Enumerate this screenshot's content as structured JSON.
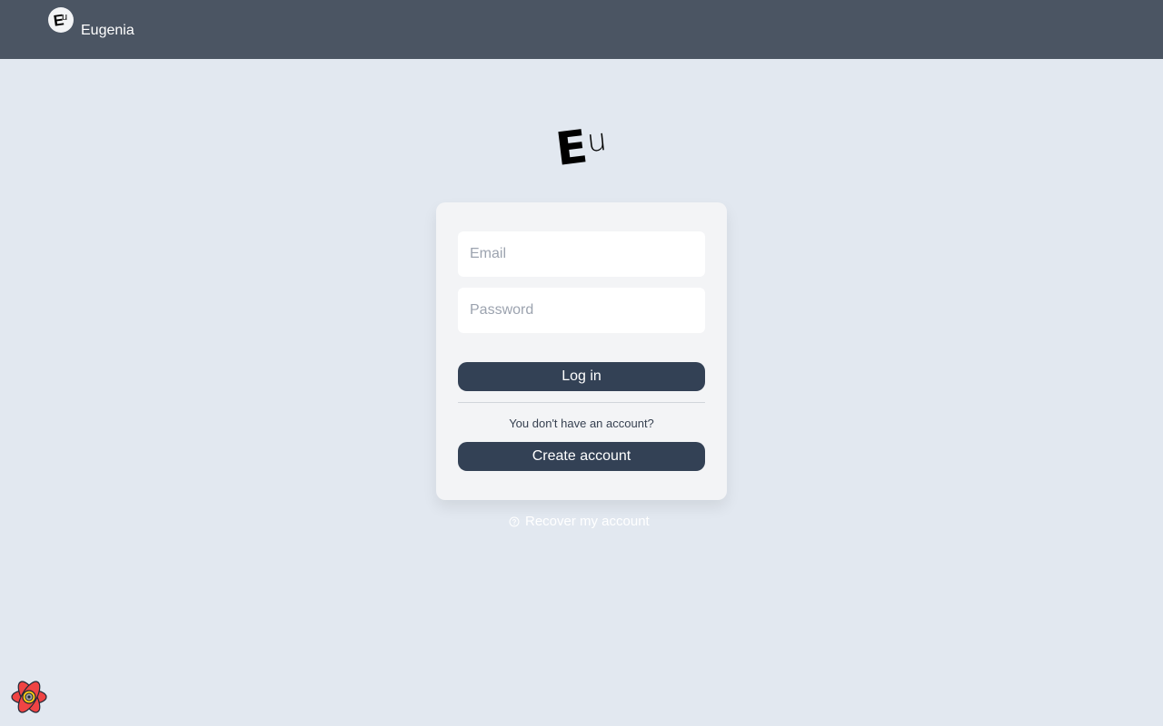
{
  "header": {
    "brand_name": "Eugenia",
    "avatar_big": "E",
    "avatar_small": "u"
  },
  "logo": {
    "big": "E",
    "small": "u"
  },
  "form": {
    "email_placeholder": "Email",
    "email_value": "",
    "password_placeholder": "Password",
    "password_value": "",
    "login_label": "Log in",
    "no_account_text": "You don't have an account?",
    "create_account_label": "Create account"
  },
  "recover": {
    "label": "Recover my account",
    "icon": "question-circle-icon"
  },
  "devtools": {
    "icon": "react-query-devtools-icon"
  },
  "colors": {
    "background": "#e2e8f0",
    "topbar": "#4b5563",
    "card": "#f3f4f6",
    "button": "#334155",
    "devtools_icon": "#ef4444"
  }
}
